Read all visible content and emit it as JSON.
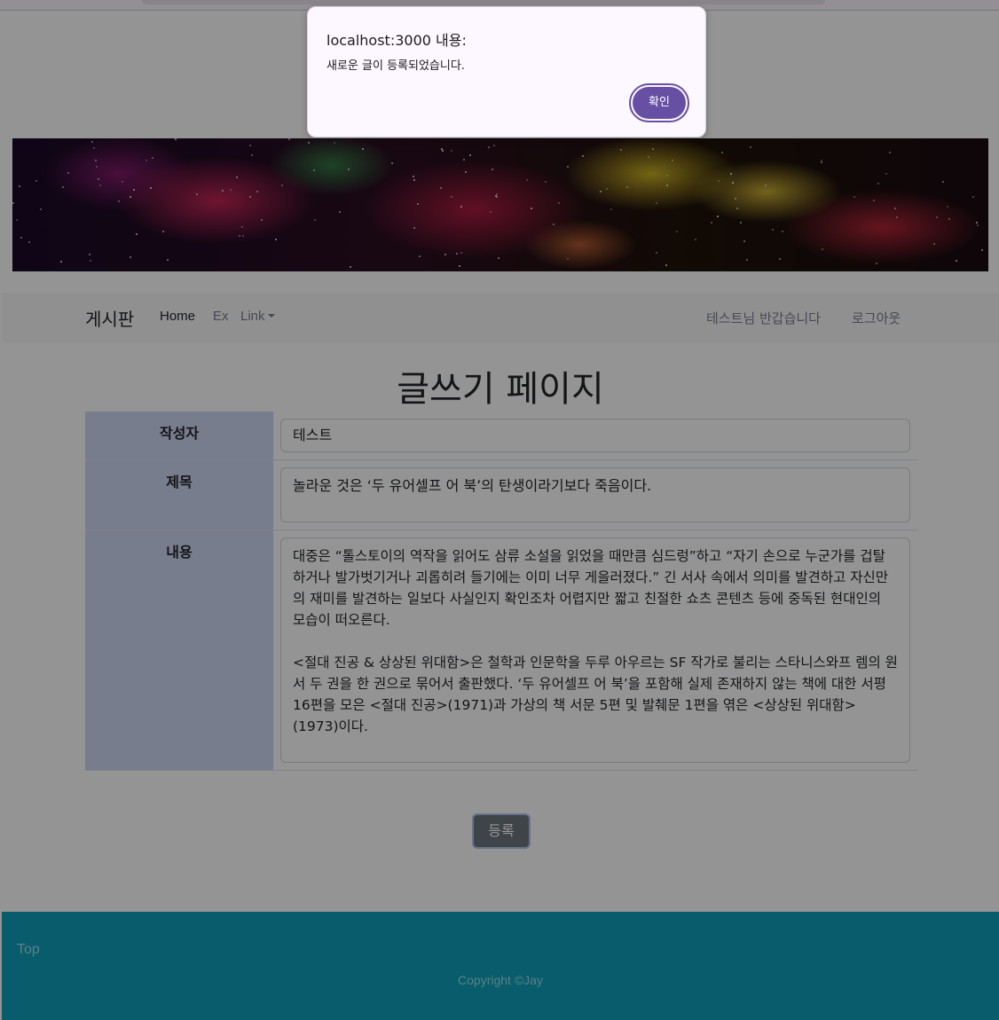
{
  "dialog": {
    "origin": "localhost:3000 내용:",
    "message": "새로운 글이 등록되었습니다.",
    "ok_label": "확인"
  },
  "navbar": {
    "brand": "게시판",
    "items": [
      {
        "label": "Home"
      },
      {
        "label": "Ex"
      },
      {
        "label": "Link"
      }
    ],
    "greeting": "테스트님 반갑습니다",
    "logout": "로그아웃"
  },
  "page": {
    "title": "글쓰기 페이지"
  },
  "form": {
    "writer_label": "작성자",
    "writer_value": "테스트",
    "title_label": "제목",
    "title_value": "놀라운 것은 ‘두 유어셀프 어 북’의 탄생이라기보다 죽음이다.",
    "content_label": "내용",
    "content_value": "대중은 “톨스토이의 역작을 읽어도 삼류 소설을 읽었을 때만큼 심드렁”하고 “자기 손으로 누군가를 겁탈하거나 발가벗기거나 괴롭히려 들기에는 이미 너무 게을러졌다.” 긴 서사 속에서 의미를 발견하고 자신만의 재미를 발견하는 일보다 사실인지 확인조차 어렵지만 짧고 친절한 쇼츠 콘텐츠 등에 중독된 현대인의 모습이 떠오른다.\n\n<절대 진공 & 상상된 위대함>은 철학과 인문학을 두루 아우르는 SF 작가로 불리는 스타니스와프 렘의 원서 두 권을 한 권으로 묶어서 출판했다. ‘두 유어셀프 어 북’을 포함해 실제 존재하지 않는 책에 대한 서평 16편을 모은 <절대 진공>(1971)과 가상의 책 서문 5편 및 발췌문 1편을 엮은 <상상된 위대함>(1973)이다.",
    "submit_label": "등록"
  },
  "footer": {
    "top_link": "Top",
    "copyright": "Copyright ©Jay"
  },
  "colors": {
    "label_bg": "#cfd8f4",
    "footer_bg": "#0e9fb9",
    "dialog_accent": "#6750a4",
    "submit_bg": "#6c757d"
  }
}
